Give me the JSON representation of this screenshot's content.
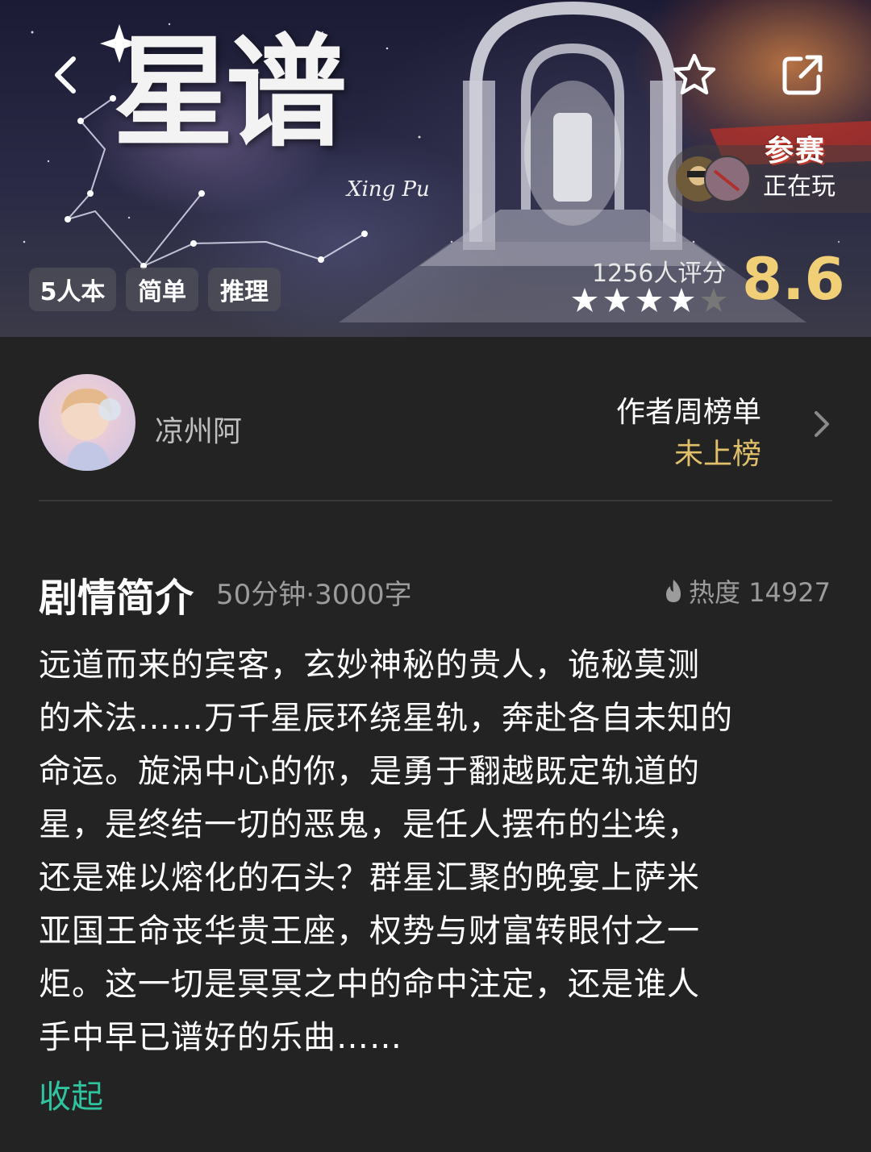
{
  "banner": {
    "title": "星谱",
    "title_romanized": "Xing Pu",
    "tags": [
      "5人本",
      "简单",
      "推理"
    ],
    "contest_badge": "参赛",
    "playing_label": "正在玩",
    "rating_count": "1256人评分",
    "rating_score": "8.6",
    "rating_stars_filled": 4,
    "rating_stars_total": 5,
    "accent_color": "#f1cf76"
  },
  "nav": {
    "back_icon": "chevron-left-icon",
    "favorite_icon": "star-outline-icon",
    "share_icon": "share-icon"
  },
  "author": {
    "name": "凉州阿",
    "weekly_rank_title": "作者周榜单",
    "weekly_rank_status": "未上榜"
  },
  "synopsis": {
    "title": "剧情简介",
    "meta": "50分钟·3000字",
    "heat_label": "热度 14927",
    "lines": [
      "远道而来的宾客，玄妙神秘的贵人，诡秘莫测",
      "的术法……万千星辰环绕星轨，奔赴各自未知的",
      "命运。旋涡中心的你，是勇于翻越既定轨道的",
      "星，是终结一切的恶鬼，是任人摆布的尘埃，",
      "还是难以熔化的石头？群星汇聚的晚宴上萨米",
      "亚国王命丧华贵王座，权势与财富转眼付之一",
      "炬。这一切是冥冥之中的命中注定，还是谁人",
      "手中早已谱好的乐曲……"
    ],
    "collapse_label": "收起",
    "collapse_color": "#2fc4a0"
  }
}
